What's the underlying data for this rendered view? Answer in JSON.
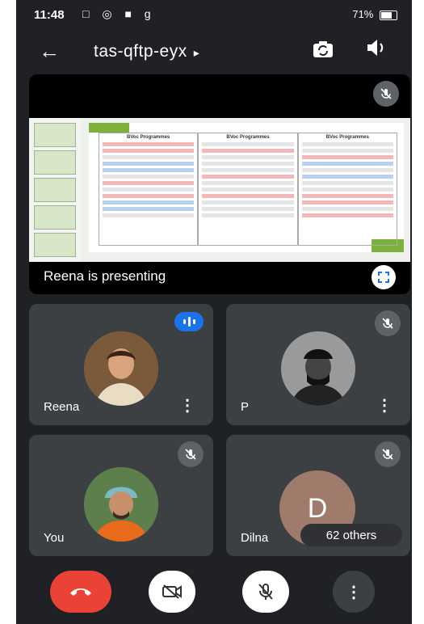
{
  "status_bar": {
    "time": "11:48",
    "app_icons": "□ ◎ ■ g",
    "right_text": "▯ ¥ᵢₗₗ ⁺ᵀₗₗ .ₗₗ 71%",
    "battery_percent": "71%"
  },
  "header": {
    "back_icon": "arrow-left-icon",
    "meeting_code": "tas-qftp-eyx",
    "code_arrow": "▸",
    "camera_switch_icon": "camera-switch-icon",
    "speaker_icon": "speaker-icon"
  },
  "presentation": {
    "label": "Reena is presenting",
    "muted": true,
    "slide_headers": [
      "BVoc Programmes",
      "BVoc Programmes",
      "BVoc Programmes"
    ]
  },
  "participants": [
    {
      "name": "Reena",
      "speaking": true
    },
    {
      "name": "P",
      "muted": true
    },
    {
      "name": "You",
      "muted": true
    },
    {
      "name": "Dilna",
      "initial": "D",
      "muted": true,
      "others_label": "62 others"
    }
  ],
  "controls": {
    "end_call_icon": "end-call-icon",
    "camera_off_icon": "camera-off-icon",
    "mic_off_icon": "mic-off-icon",
    "more_icon": "more-vert-icon"
  },
  "colors": {
    "background": "#202124",
    "tile": "#3c4043",
    "end_call": "#ea4335",
    "speaking_badge": "#1a73e8"
  }
}
